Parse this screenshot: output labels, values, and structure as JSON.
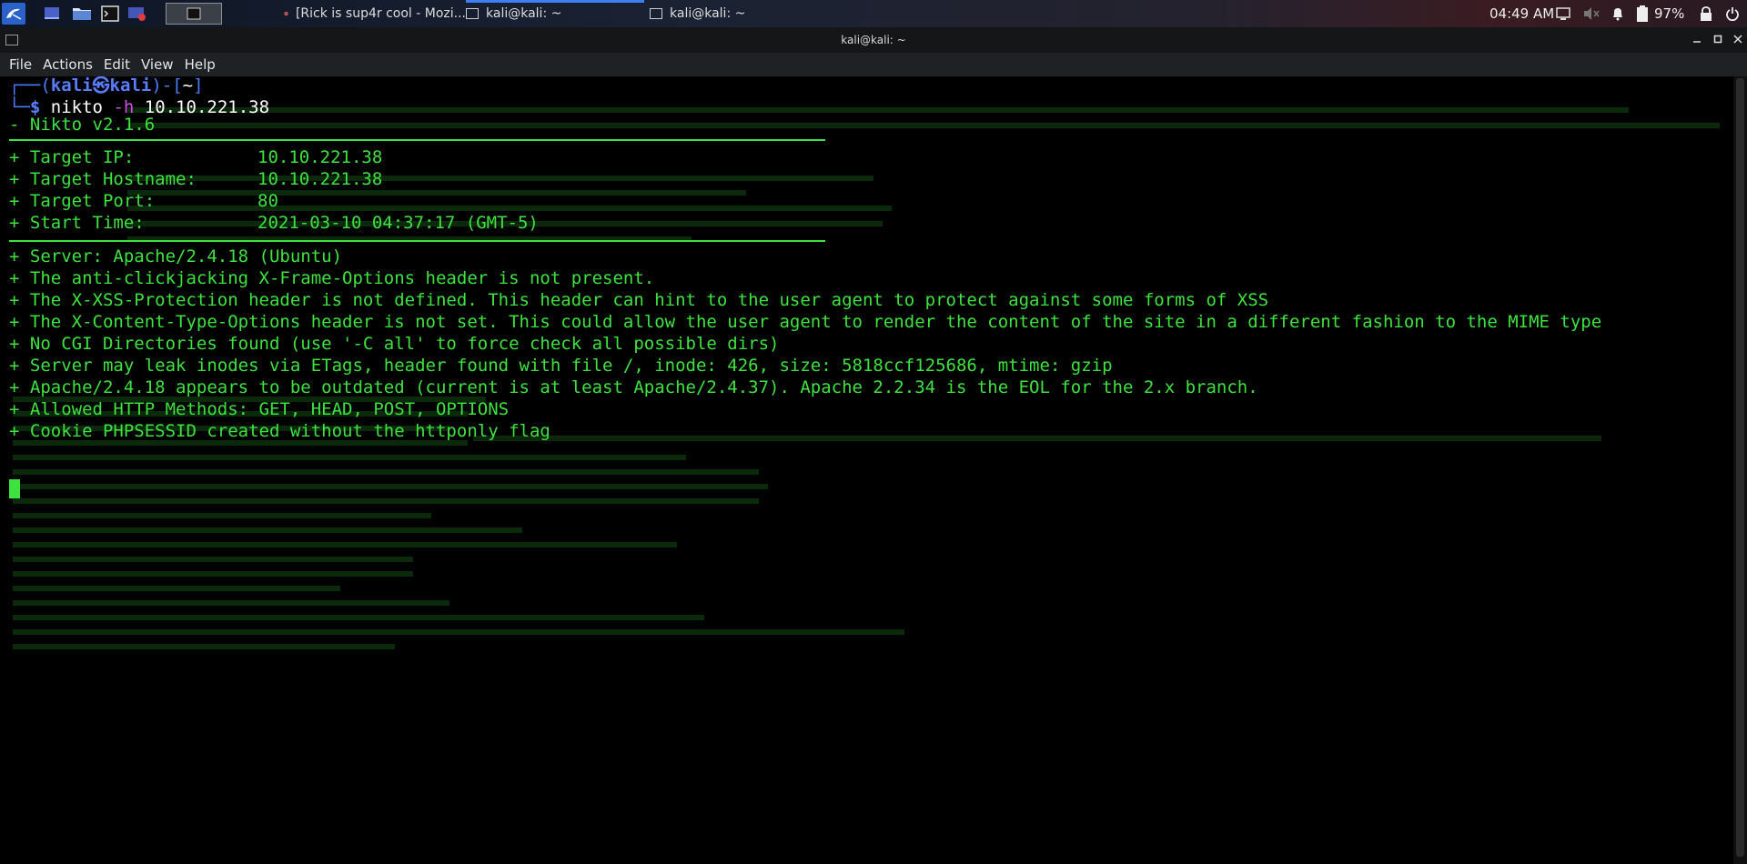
{
  "panel": {
    "tasks": {
      "firefox": "[Rick is sup4r cool - Mozi...",
      "term1": "kali@kali: ~",
      "term2": "kali@kali: ~"
    },
    "clock": "04:49 AM",
    "battery": "97%"
  },
  "window": {
    "title": "kali@kali: ~",
    "menu": [
      "File",
      "Actions",
      "Edit",
      "View",
      "Help"
    ]
  },
  "terminal": {
    "prompt": {
      "user": "kali",
      "host": "kali",
      "dir": "~",
      "command": "nikto",
      "flag": "-h",
      "arg": "10.10.221.38"
    },
    "version": "- Nikto v2.1.6",
    "targets": [
      {
        "label": "+ Target IP:",
        "value": "10.10.221.38"
      },
      {
        "label": "+ Target Hostname:",
        "value": "10.10.221.38"
      },
      {
        "label": "+ Target Port:",
        "value": "80"
      },
      {
        "label": "+ Start Time:",
        "value": "2021-03-10 04:37:17 (GMT-5)"
      }
    ],
    "findings": [
      "+ Server: Apache/2.4.18 (Ubuntu)",
      "+ The anti-clickjacking X-Frame-Options header is not present.",
      "+ The X-XSS-Protection header is not defined. This header can hint to the user agent to protect against some forms of XSS",
      "+ The X-Content-Type-Options header is not set. This could allow the user agent to render the content of the site in a different fashion to the MIME type",
      "+ No CGI Directories found (use '-C all' to force check all possible dirs)",
      "+ Server may leak inodes via ETags, header found with file /, inode: 426, size: 5818ccf125686, mtime: gzip",
      "+ Apache/2.4.18 appears to be outdated (current is at least Apache/2.4.37). Apache 2.2.34 is the EOL for the 2.x branch.",
      "+ Allowed HTTP Methods: GET, HEAD, POST, OPTIONS",
      "+ Cookie PHPSESSID created without the httponly flag"
    ]
  },
  "colors": {
    "terminal_text": "#3ee23e",
    "prompt_blue": "#5a7dff",
    "accent": "#3f7ff5"
  }
}
